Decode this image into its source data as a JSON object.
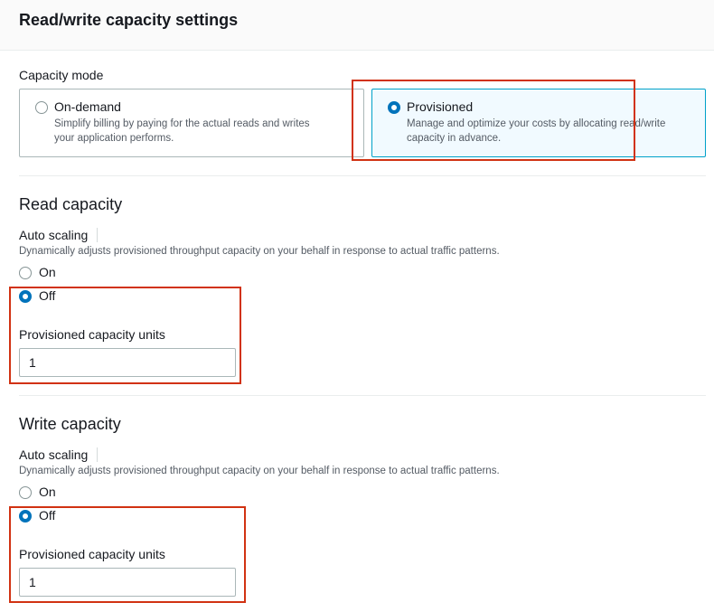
{
  "header": {
    "title": "Read/write capacity settings"
  },
  "capacity_mode": {
    "label": "Capacity mode",
    "options": [
      {
        "title": "On-demand",
        "desc_line1": "Simplify billing by paying for the actual reads and writes",
        "desc_line2": "your application performs.",
        "selected": false
      },
      {
        "title": "Provisioned",
        "desc_line1": "Manage and optimize your costs by allocating read/write",
        "desc_line2": "capacity in advance.",
        "selected": true
      }
    ]
  },
  "read": {
    "title": "Read capacity",
    "auto_scaling_label": "Auto scaling",
    "auto_scaling_desc": "Dynamically adjusts provisioned throughput capacity on your behalf in response to actual traffic patterns.",
    "on_label": "On",
    "off_label": "Off",
    "selected": "Off",
    "units_label": "Provisioned capacity units",
    "units_value": "1"
  },
  "write": {
    "title": "Write capacity",
    "auto_scaling_label": "Auto scaling",
    "auto_scaling_desc": "Dynamically adjusts provisioned throughput capacity on your behalf in response to actual traffic patterns.",
    "on_label": "On",
    "off_label": "Off",
    "selected": "Off",
    "units_label": "Provisioned capacity units",
    "units_value": "1"
  },
  "colors": {
    "accent": "#0073bb",
    "highlight": "#d13212",
    "selected_tile_bg": "#f1faff"
  }
}
